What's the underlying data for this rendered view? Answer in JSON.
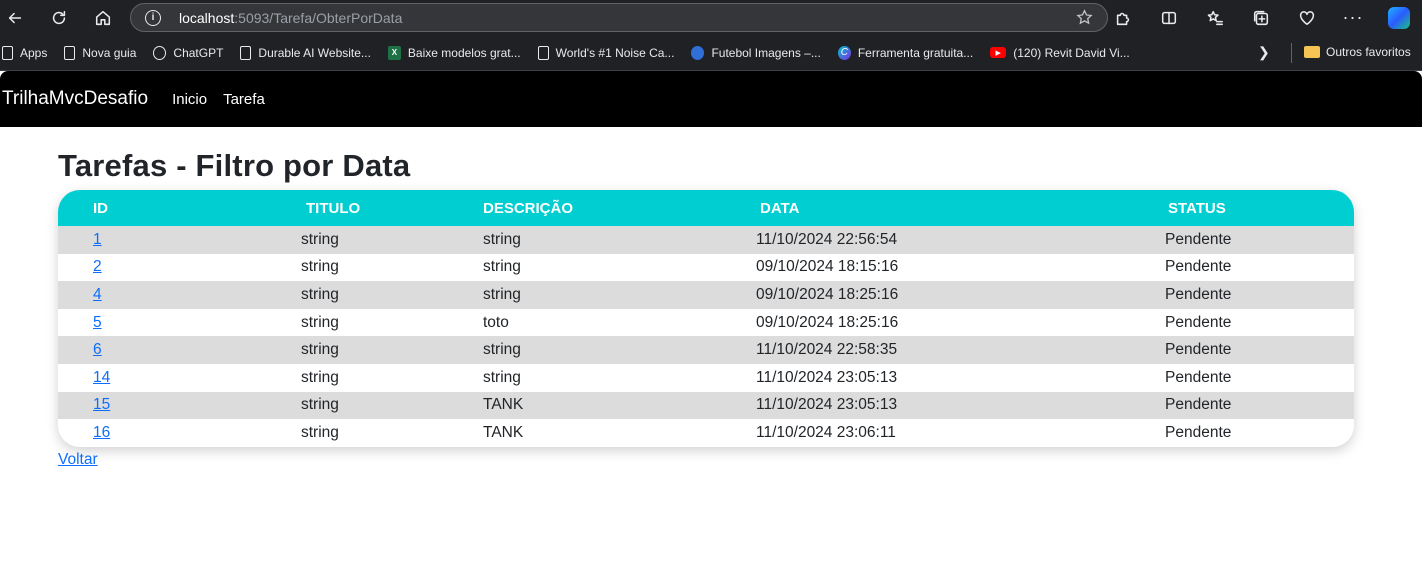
{
  "browser": {
    "url_host": "localhost",
    "url_rest": ":5093/Tarefa/ObterPorData",
    "bookmarks": [
      {
        "label": "Apps",
        "icon": "apps-grid-icon"
      },
      {
        "label": "Nova guia",
        "icon": "page-icon"
      },
      {
        "label": "ChatGPT",
        "icon": "chatgpt-icon"
      },
      {
        "label": "Durable AI Website...",
        "icon": "page-icon"
      },
      {
        "label": "Baixe modelos grat...",
        "icon": "excel-icon"
      },
      {
        "label": "World's #1 Noise Ca...",
        "icon": "page-icon"
      },
      {
        "label": "Futebol Imagens –...",
        "icon": "ball-icon"
      },
      {
        "label": "Ferramenta gratuita...",
        "icon": "canva-icon"
      },
      {
        "label": "(120) Revit David Vi...",
        "icon": "youtube-icon"
      }
    ],
    "other_favorites": "Outros favoritos"
  },
  "navbar": {
    "brand": "TrilhaMvcDesafio",
    "links": [
      "Inicio",
      "Tarefa"
    ]
  },
  "page": {
    "title": "Tarefas - Filtro por Data",
    "back_link": "Voltar"
  },
  "table": {
    "headers": [
      "ID",
      "TITULO",
      "DESCRIÇÃO",
      "DATA",
      "STATUS"
    ],
    "rows": [
      {
        "id": "1",
        "titulo": "string",
        "descricao": "string",
        "data": "11/10/2024 22:56:54",
        "status": "Pendente"
      },
      {
        "id": "2",
        "titulo": "string",
        "descricao": "string",
        "data": "09/10/2024 18:15:16",
        "status": "Pendente"
      },
      {
        "id": "4",
        "titulo": "string",
        "descricao": "string",
        "data": "09/10/2024 18:25:16",
        "status": "Pendente"
      },
      {
        "id": "5",
        "titulo": "string",
        "descricao": "toto",
        "data": "09/10/2024 18:25:16",
        "status": "Pendente"
      },
      {
        "id": "6",
        "titulo": "string",
        "descricao": "string",
        "data": "11/10/2024 22:58:35",
        "status": "Pendente"
      },
      {
        "id": "14",
        "titulo": "string",
        "descricao": "string",
        "data": "11/10/2024 23:05:13",
        "status": "Pendente"
      },
      {
        "id": "15",
        "titulo": "string",
        "descricao": "TANK",
        "data": "11/10/2024 23:05:13",
        "status": "Pendente"
      },
      {
        "id": "16",
        "titulo": "string",
        "descricao": "TANK",
        "data": "11/10/2024 23:06:11",
        "status": "Pendente"
      }
    ]
  },
  "colors": {
    "header_bg": "#00ced1",
    "navbar_bg": "#000000",
    "link": "#0d6efd",
    "stripe": "#dcdcdc"
  }
}
